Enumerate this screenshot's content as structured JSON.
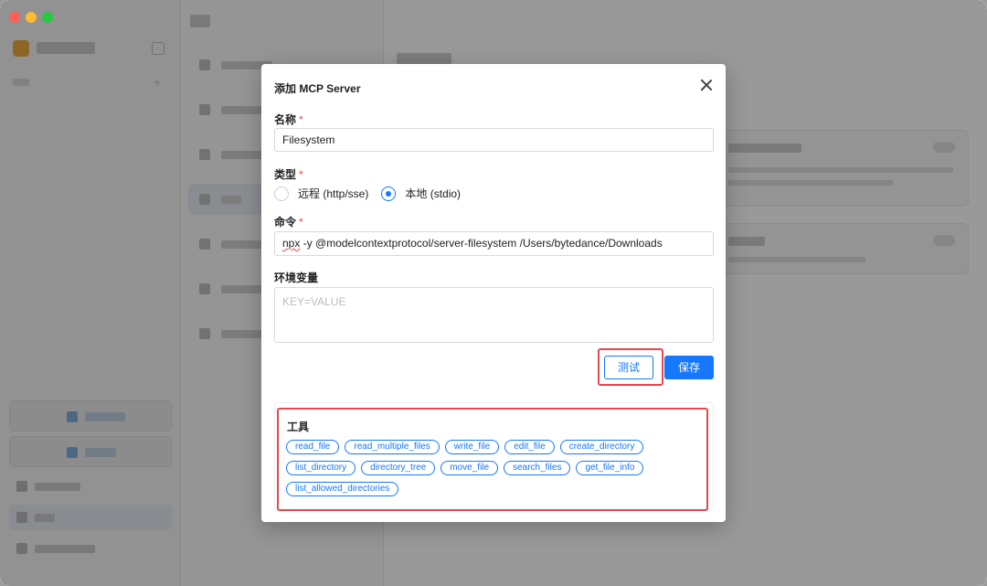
{
  "modal": {
    "title": "添加 MCP Server",
    "name_label": "名称",
    "name_value": "Filesystem",
    "type_label": "类型",
    "type_options": [
      {
        "label": "远程 (http/sse)",
        "selected": false
      },
      {
        "label": "本地 (stdio)",
        "selected": true
      }
    ],
    "command_label": "命令",
    "command_value_prefix": "npx",
    "command_value_rest": " -y @modelcontextprotocol/server-filesystem /Users/bytedance/Downloads",
    "env_label": "环境变量",
    "env_placeholder": "KEY=VALUE",
    "required_mark": "*",
    "test_button": "测试",
    "save_button": "保存",
    "tools_title": "工具",
    "tools": [
      "read_file",
      "read_multiple_files",
      "write_file",
      "edit_file",
      "create_directory",
      "list_directory",
      "directory_tree",
      "move_file",
      "search_files",
      "get_file_info",
      "list_allowed_directories"
    ]
  },
  "colors": {
    "accent": "#1677ff",
    "highlight": "#e5484d"
  }
}
